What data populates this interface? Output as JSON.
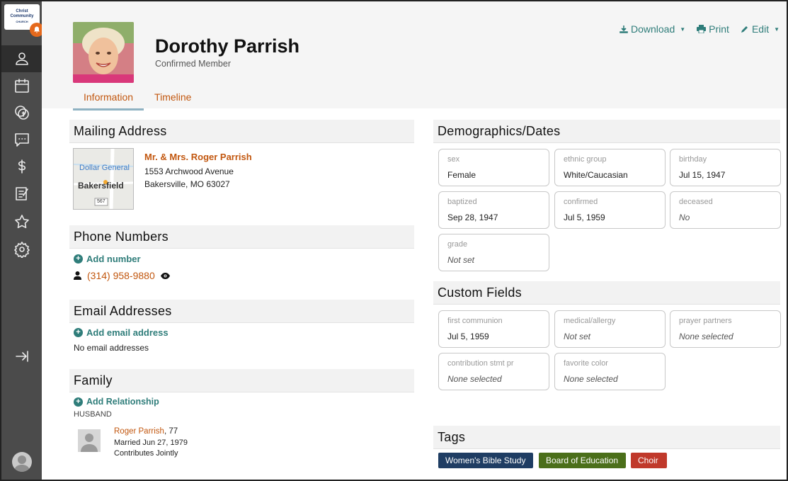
{
  "app": {
    "logo_lines": [
      "Christ",
      "Community",
      "CHURCH"
    ],
    "nav": [
      {
        "name": "people",
        "icon": "people-icon"
      },
      {
        "name": "calendar",
        "icon": "calendar-icon"
      },
      {
        "name": "giving",
        "icon": "coins-icon"
      },
      {
        "name": "messages",
        "icon": "chat-icon"
      },
      {
        "name": "finance",
        "icon": "dollar-icon"
      },
      {
        "name": "forms",
        "icon": "clipboard-icon"
      },
      {
        "name": "favorites",
        "icon": "star-icon"
      },
      {
        "name": "settings",
        "icon": "gear-icon"
      },
      {
        "name": "collapse",
        "icon": "expand-arrow-icon"
      }
    ]
  },
  "person": {
    "name": "Dorothy Parrish",
    "status": "Confirmed Member"
  },
  "actions": {
    "download": "Download",
    "print": "Print",
    "edit": "Edit"
  },
  "tabs": [
    {
      "label": "Information",
      "active": true
    },
    {
      "label": "Timeline",
      "active": false
    }
  ],
  "mailing": {
    "title": "Mailing Address",
    "addressee": "Mr. & Mrs. Roger Parrish",
    "line1": "1553 Archwood Avenue",
    "line2": "Bakersville, MO 63027",
    "map": {
      "poi": "Dollar General",
      "town": "Bakersfield",
      "route": "567"
    }
  },
  "phones": {
    "title": "Phone Numbers",
    "add_label": "Add number",
    "items": [
      {
        "number": "(314) 958-9880"
      }
    ]
  },
  "emails": {
    "title": "Email Addresses",
    "add_label": "Add email address",
    "empty_text": "No email addresses"
  },
  "family": {
    "title": "Family",
    "add_label": "Add Relationship",
    "relation": "HUSBAND",
    "member_name": "Roger Parrish",
    "member_age": ", 77",
    "married": "Married Jun 27, 1979",
    "note": "Contributes Jointly"
  },
  "demographics": {
    "title": "Demographics/Dates",
    "fields": [
      {
        "label": "sex",
        "value": "Female",
        "muted": false
      },
      {
        "label": "ethnic group",
        "value": "White/Caucasian",
        "muted": false
      },
      {
        "label": "birthday",
        "value": "Jul 15, 1947",
        "muted": false
      },
      {
        "label": "baptized",
        "value": "Sep 28, 1947",
        "muted": false
      },
      {
        "label": "confirmed",
        "value": "Jul 5, 1959",
        "muted": false
      },
      {
        "label": "deceased",
        "value": "No",
        "muted": true
      },
      {
        "label": "grade",
        "value": "Not set",
        "muted": true
      }
    ]
  },
  "custom": {
    "title": "Custom Fields",
    "fields": [
      {
        "label": "first communion",
        "value": "Jul 5, 1959",
        "muted": false
      },
      {
        "label": "medical/allergy",
        "value": "Not set",
        "muted": true
      },
      {
        "label": "prayer partners",
        "value": "None selected",
        "muted": true
      },
      {
        "label": "contribution stmt pr",
        "value": "None selected",
        "muted": true
      },
      {
        "label": "favorite color",
        "value": "None selected",
        "muted": true
      }
    ]
  },
  "tags": {
    "title": "Tags",
    "items": [
      {
        "label": "Women's Bible Study",
        "color": "#1f3d63"
      },
      {
        "label": "Board of Education",
        "color": "#4b6f1a"
      },
      {
        "label": "Choir",
        "color": "#c0392b"
      }
    ]
  },
  "colors": {
    "accent": "#c2570f",
    "teal": "#2f7d7a",
    "sidebar": "#4b4b4b"
  }
}
